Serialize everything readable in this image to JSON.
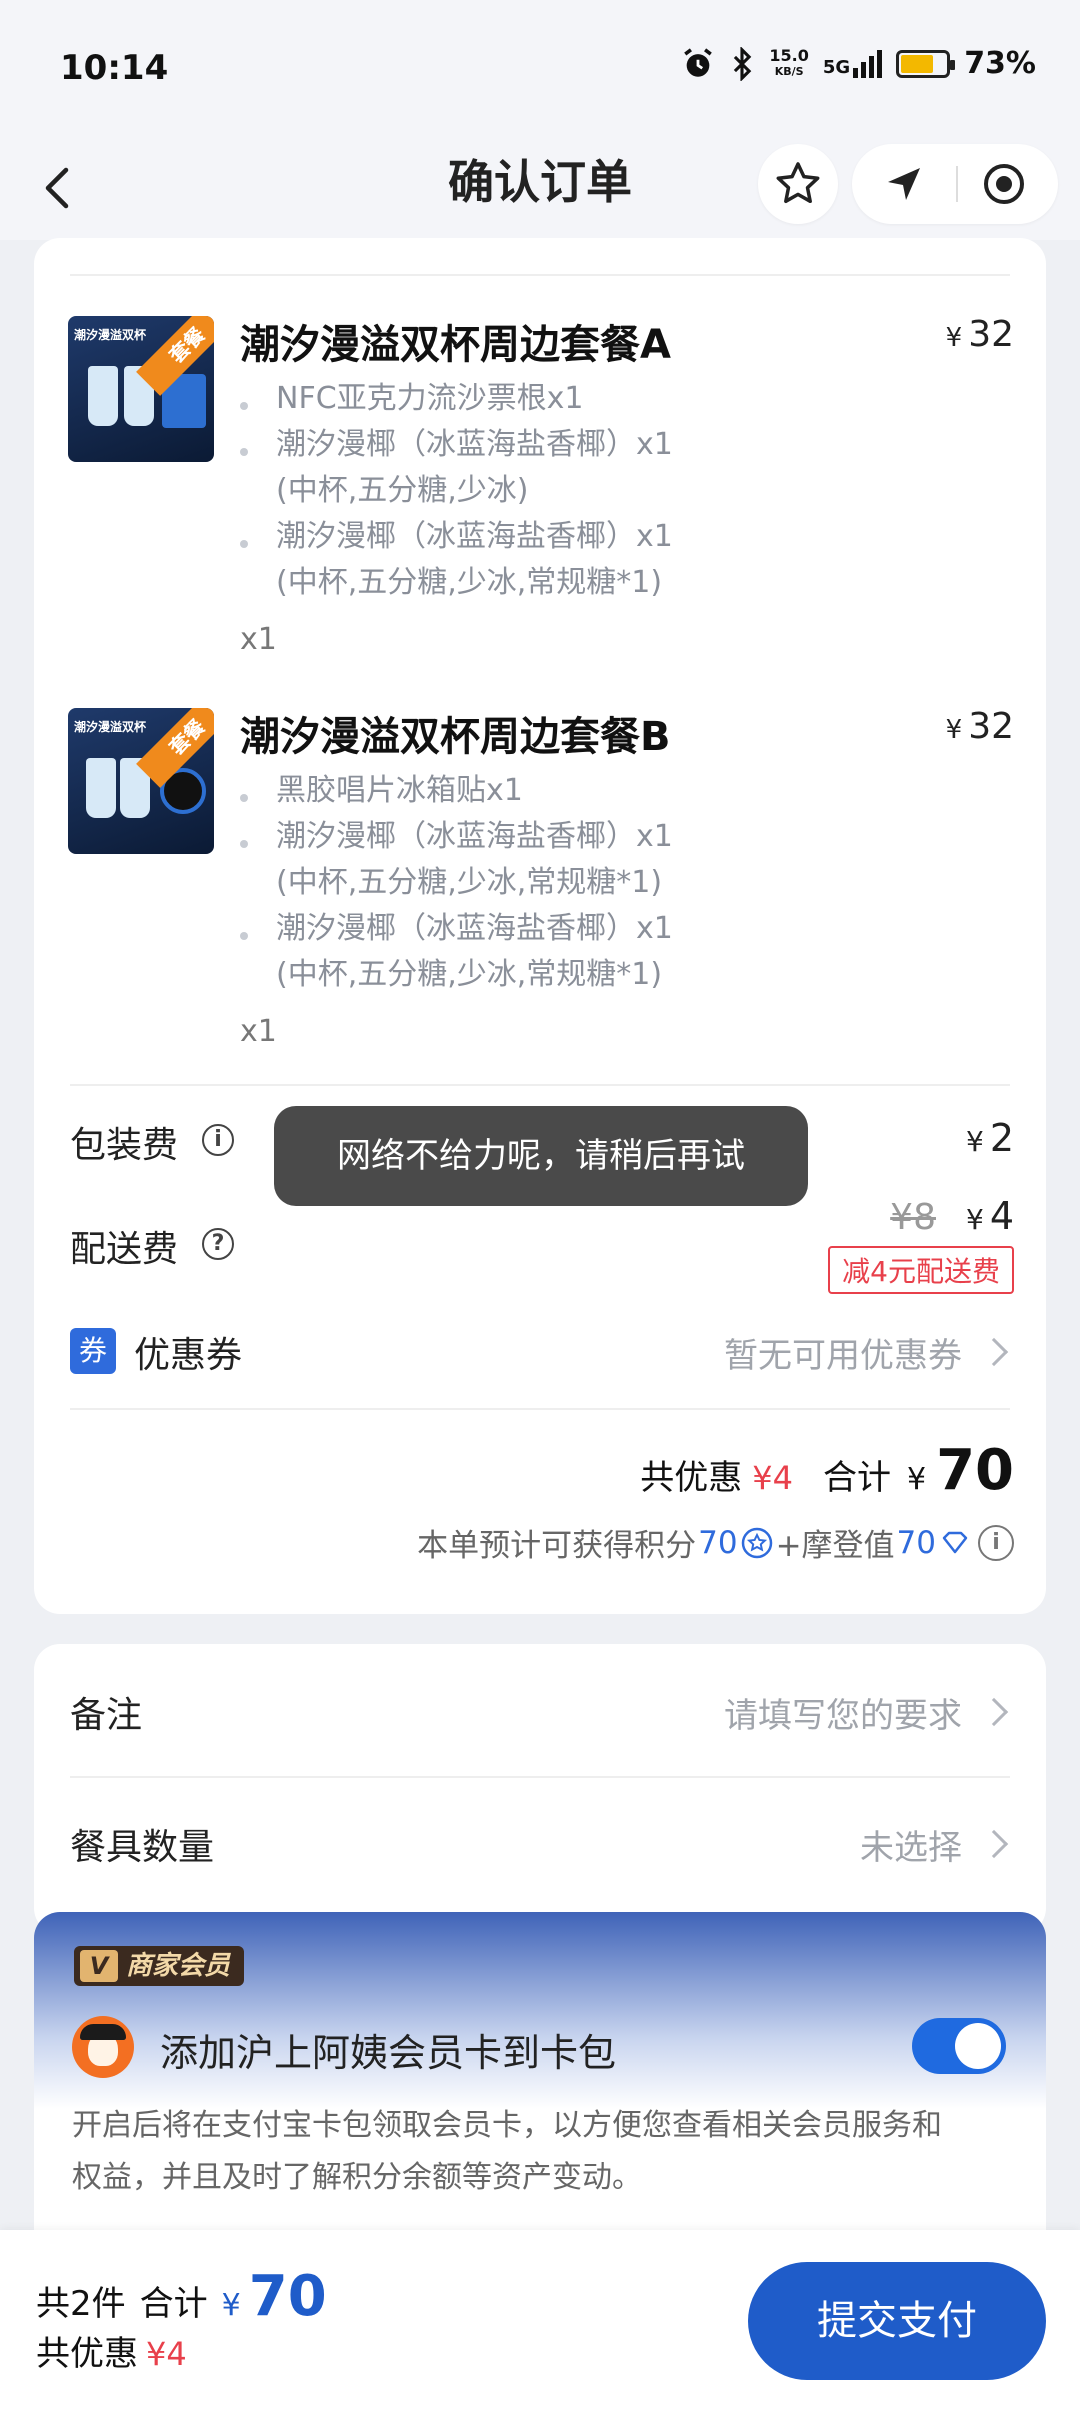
{
  "status": {
    "time": "10:14",
    "net_speed": "15.0",
    "net_unit": "KB/S",
    "signal": "5G",
    "battery": "73%",
    "battery_level": 0.73
  },
  "nav": {
    "title": "确认订单"
  },
  "items": [
    {
      "thumb_text": "潮汐漫溢双杯",
      "badge": "套餐",
      "title": "潮汐漫溢双杯周边套餐A",
      "price_symbol": "¥",
      "price": "32",
      "lines": [
        {
          "text": "NFC亚克力流沙票根x1",
          "bullet": true
        },
        {
          "text": "潮汐漫椰（冰蓝海盐香椰）x1",
          "bullet": true
        },
        {
          "text": "(中杯,五分糖,少冰)",
          "bullet": false
        },
        {
          "text": "潮汐漫椰（冰蓝海盐香椰）x1",
          "bullet": true
        },
        {
          "text": "(中杯,五分糖,少冰,常规糖*1)",
          "bullet": false
        }
      ],
      "qty": "x1"
    },
    {
      "thumb_text": "潮汐漫溢双杯",
      "badge": "套餐",
      "title": "潮汐漫溢双杯周边套餐B",
      "price_symbol": "¥",
      "price": "32",
      "lines": [
        {
          "text": "黑胶唱片冰箱贴x1",
          "bullet": true
        },
        {
          "text": "潮汐漫椰（冰蓝海盐香椰）x1",
          "bullet": true
        },
        {
          "text": "(中杯,五分糖,少冰,常规糖*1)",
          "bullet": false
        },
        {
          "text": "潮汐漫椰（冰蓝海盐香椰）x1",
          "bullet": true
        },
        {
          "text": "(中杯,五分糖,少冰,常规糖*1)",
          "bullet": false
        }
      ],
      "qty": "x1"
    }
  ],
  "fees": {
    "packaging_label": "包装费",
    "packaging_price": "2",
    "delivery_label": "配送费",
    "delivery_original": "¥8",
    "delivery_price": "4",
    "delivery_discount_tag": "减4元配送费",
    "yen": "¥"
  },
  "coupon": {
    "badge": "券",
    "label": "优惠券",
    "value": "暂无可用优惠券"
  },
  "summary": {
    "discount_label": "共优惠",
    "discount_value": "¥4",
    "total_label": "合计",
    "total_value": "70",
    "points_text": "本单预计可获得积分",
    "points_value": "70",
    "mode_text": "+摩登值",
    "mode_value": "70"
  },
  "toast": "网络不给力呢，请稍后再试",
  "notes": {
    "label": "备注",
    "placeholder": "请填写您的要求"
  },
  "utensils": {
    "label": "餐具数量",
    "value": "未选择"
  },
  "member": {
    "badge": "商家会员",
    "title": "添加沪上阿姨会员卡到卡包",
    "toggle_on": true,
    "desc_line1": "开启后将在支付宝卡包领取会员卡，以方便您查看相关会员服务和",
    "desc_line2": "权益，并且及时了解积分余额等资产变动。"
  },
  "bottom": {
    "count": "共2件",
    "total_label": "合计",
    "total_value": "70",
    "discount_label": "共优惠",
    "discount_value": "¥4",
    "submit": "提交支付"
  }
}
